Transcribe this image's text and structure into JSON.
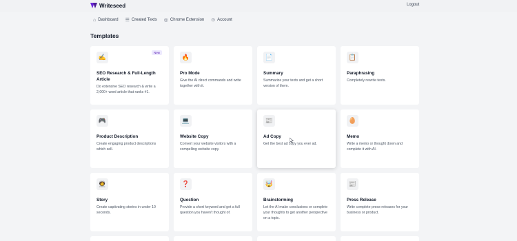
{
  "app": {
    "name": "Writeseed",
    "logout": "Logout"
  },
  "nav": [
    {
      "label": "Dashboard",
      "icon": "home-icon"
    },
    {
      "label": "Created Texts",
      "icon": "document-icon"
    },
    {
      "label": "Chrome Extension",
      "icon": "chrome-icon"
    },
    {
      "label": "Account",
      "icon": "account-icon"
    }
  ],
  "section_title": "Templates",
  "templates": [
    {
      "title": "SEO Research & Full-Length Article",
      "desc": "Do extensive SEO research & write a 2,000+ word article that ranks #1.",
      "icon": "✍️",
      "icon_name": "writing-hand-icon",
      "badge": "New"
    },
    {
      "title": "Pro Mode",
      "desc": "Give the AI direct commands and write together with it.",
      "icon": "🔥",
      "icon_name": "fire-icon"
    },
    {
      "title": "Summary",
      "desc": "Summarize your texts and get a short version of them.",
      "icon": "📄",
      "icon_name": "page-icon"
    },
    {
      "title": "Paraphrasing",
      "desc": "Completely rewrite texts.",
      "icon": "📋",
      "icon_name": "clipboard-icon"
    },
    {
      "title": "Product Description",
      "desc": "Create engaging product descriptions which sell.",
      "icon": "🎮",
      "icon_name": "game-controller-icon"
    },
    {
      "title": "Website Copy",
      "desc": "Convert your website visitors with a compelling website copy.",
      "icon": "💻",
      "icon_name": "laptop-icon"
    },
    {
      "title": "Ad Copy",
      "desc": "Get the best ad copy you ever ad.",
      "icon": "📰",
      "icon_name": "newspaper-icon"
    },
    {
      "title": "Memo",
      "desc": "Write a memo or thought down and complete it with AI.",
      "icon": "🥚",
      "icon_name": "memo-icon"
    },
    {
      "title": "Story",
      "desc": "Create captivating stories in under 10 seconds.",
      "icon": "🧑‍🚀",
      "icon_name": "person-icon"
    },
    {
      "title": "Question",
      "desc": "Provide a short keyword and get a full question you haven't thought of.",
      "icon": "❓",
      "icon_name": "question-icon"
    },
    {
      "title": "Brainstorming",
      "desc": "Let the AI make conclusions or complete your thoughts to get another perspective on a topic.",
      "icon": "🤯",
      "icon_name": "brain-icon"
    },
    {
      "title": "Press Release",
      "desc": "Write complete press-releases for your business or product.",
      "icon": "📰",
      "icon_name": "press-icon"
    }
  ]
}
